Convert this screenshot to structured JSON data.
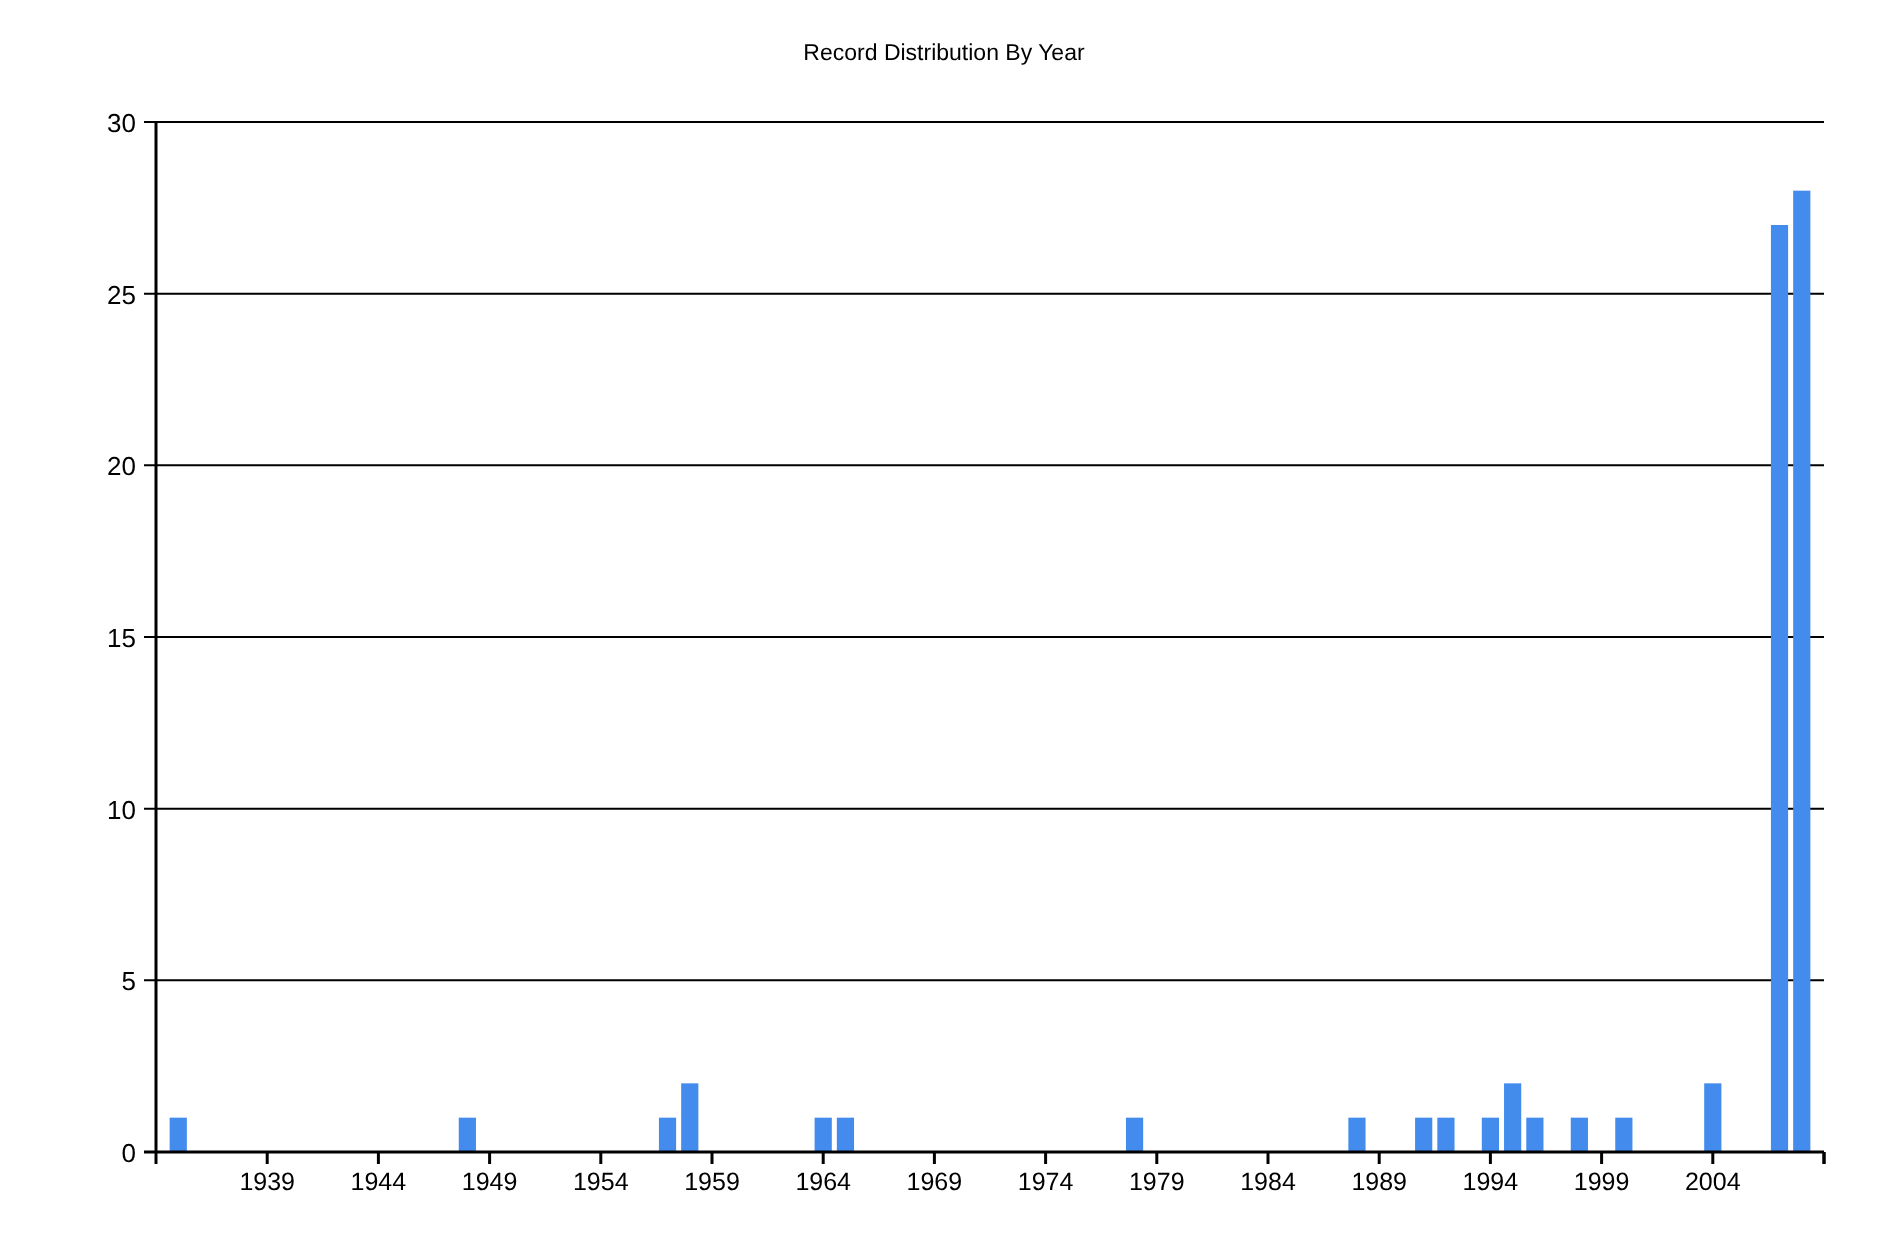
{
  "chart": {
    "chart_data": {
      "type": "bar",
      "title": "Record Distribution By Year",
      "x": [
        1935,
        1948,
        1957,
        1958,
        1964,
        1965,
        1978,
        1988,
        1991,
        1992,
        1994,
        1995,
        1996,
        1998,
        2000,
        2004,
        2007,
        2008
      ],
      "grid": true,
      "series": [
        {
          "color": "#438cee",
          "values": [
            1,
            1,
            1,
            2,
            1,
            1,
            1,
            1,
            1,
            1,
            1,
            2,
            1,
            1,
            1,
            2,
            27,
            28
          ]
        }
      ],
      "xlim": [
        1934,
        2009
      ],
      "ylim": [
        0,
        30
      ],
      "xticks": [
        1939,
        1944,
        1949,
        1954,
        1959,
        1964,
        1969,
        1974,
        1979,
        1984,
        1989,
        1994,
        1999,
        2004
      ],
      "yticks": [
        0,
        5,
        10,
        15,
        20,
        25,
        30
      ]
    }
  }
}
